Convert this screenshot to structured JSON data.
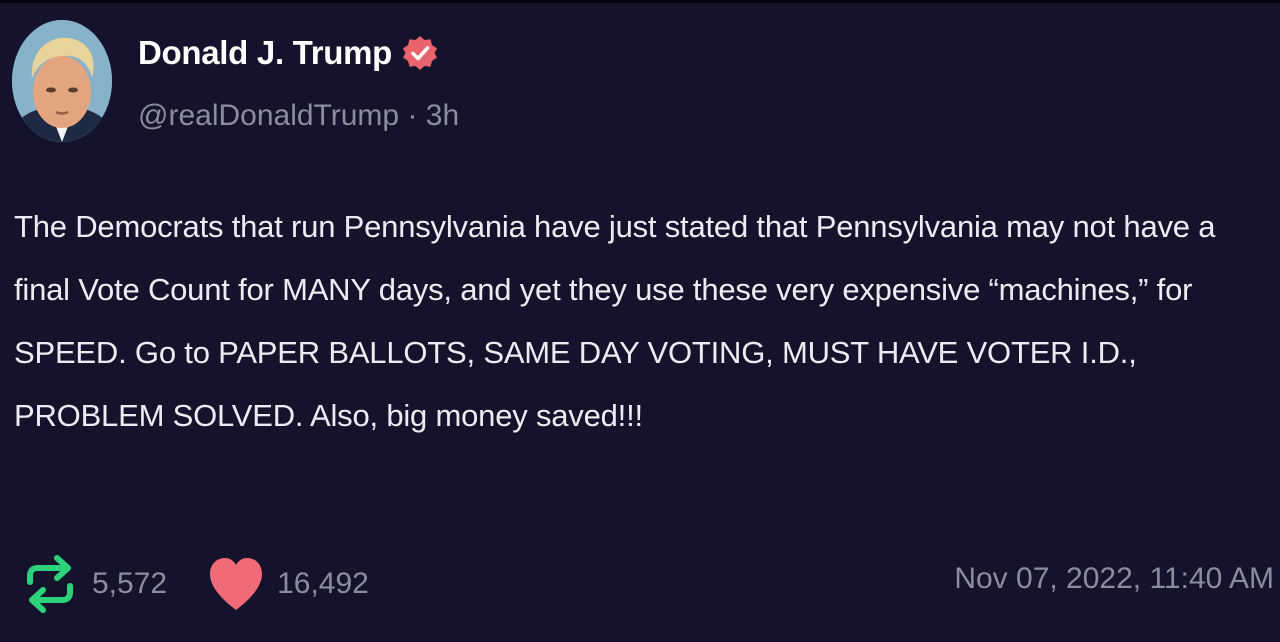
{
  "post": {
    "author": {
      "display_name": "Donald J. Trump",
      "verified": true,
      "avatar_icon": "profile-photo"
    },
    "handle": "@realDonaldTrump",
    "separator": "·",
    "relative_time": "3h",
    "text": "The Democrats that run Pennsylvania have just stated that Pennsylvania may not have a final Vote Count for MANY days, and yet they use these very expensive “machines,” for SPEED. Go to PAPER BALLOTS, SAME DAY VOTING, MUST HAVE VOTER I.D., PROBLEM SOLVED. Also, big money saved!!!",
    "stats": {
      "retweets": "5,572",
      "likes": "16,492"
    },
    "timestamp": "Nov 07, 2022, 11:40 AM"
  },
  "colors": {
    "background": "#15132b",
    "verified_badge": "#e8636b",
    "retweet_icon": "#2bd27a",
    "heart_icon": "#f06a78",
    "secondary_text": "#8c8ca0"
  },
  "icons": {
    "verified": "verified-badge-icon",
    "retweet": "retweet-icon",
    "like": "heart-icon"
  }
}
